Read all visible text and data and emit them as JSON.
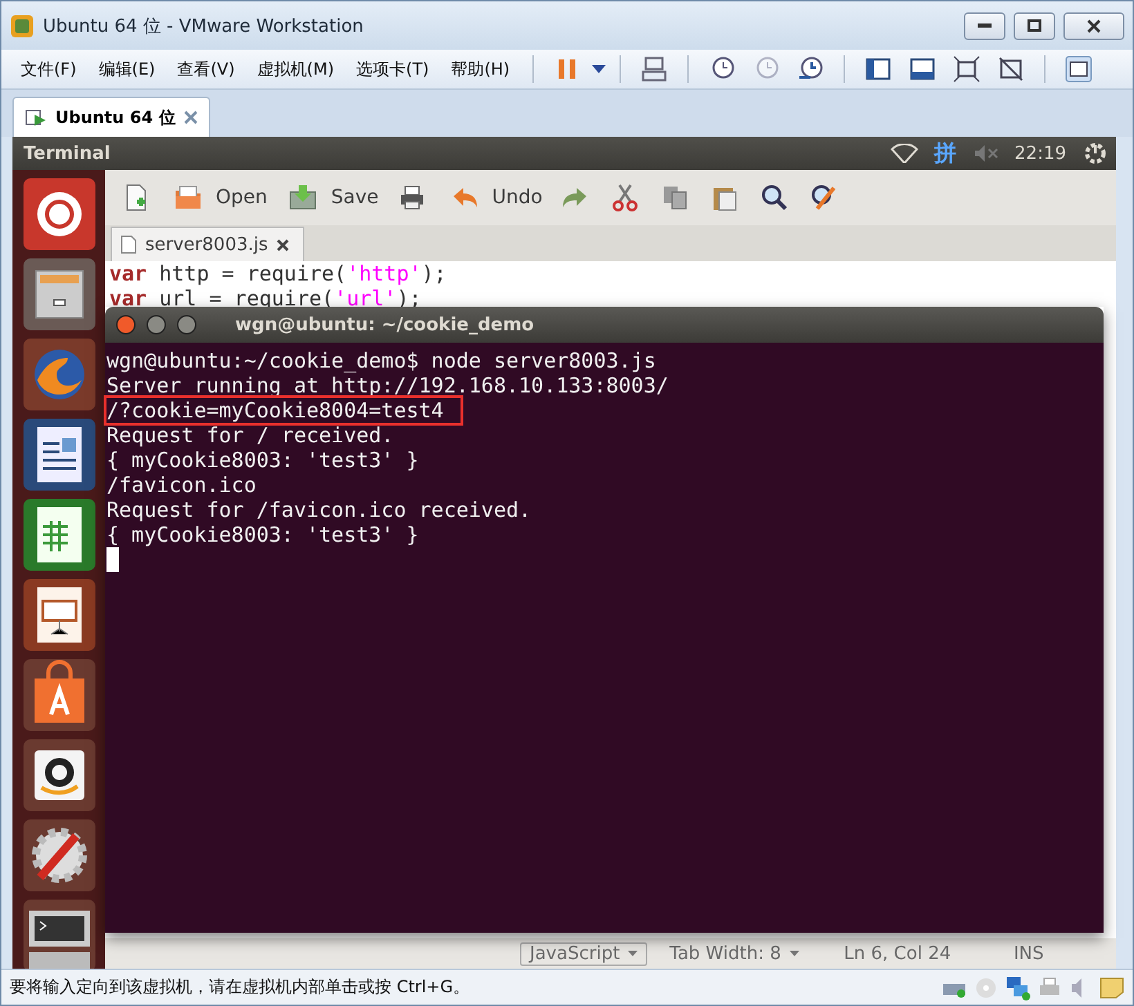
{
  "window": {
    "title": "Ubuntu 64 位 - VMware Workstation"
  },
  "menu": [
    "文件(F)",
    "编辑(E)",
    "查看(V)",
    "虚拟机(M)",
    "选项卡(T)",
    "帮助(H)"
  ],
  "tabs": [
    {
      "label": "Ubuntu 64 位",
      "selected": true
    }
  ],
  "ubuntu_panel": {
    "app_title": "Terminal",
    "input_method": "拼",
    "clock": "22:19"
  },
  "editor": {
    "toolbar": [
      {
        "kind": "new"
      },
      {
        "kind": "open",
        "label": "Open"
      },
      {
        "kind": "save",
        "label": "Save"
      },
      {
        "kind": "print"
      },
      {
        "kind": "undo",
        "label": "Undo"
      },
      {
        "kind": "redo"
      },
      {
        "kind": "cut"
      },
      {
        "kind": "copy"
      },
      {
        "kind": "paste"
      },
      {
        "kind": "find"
      },
      {
        "kind": "replace"
      }
    ],
    "file_tab": "server8003.js",
    "code": [
      [
        {
          "kind": "keyword",
          "text": "var"
        },
        {
          "kind": "plain",
          "text": " http = require("
        },
        {
          "kind": "string",
          "text": "'http'"
        },
        {
          "kind": "plain",
          "text": ");"
        }
      ],
      [
        {
          "kind": "keyword",
          "text": "var"
        },
        {
          "kind": "plain",
          "text": " url = require("
        },
        {
          "kind": "string",
          "text": "'url'"
        },
        {
          "kind": "plain",
          "text": ");"
        }
      ]
    ],
    "status": {
      "language": "JavaScript",
      "tab_width": "Tab Width: 8",
      "position": "Ln 6, Col 24",
      "mode": "INS"
    }
  },
  "terminal": {
    "title": "wgn@ubuntu: ~/cookie_demo",
    "lines": [
      {
        "text": "wgn@ubuntu:~/cookie_demo$ node server8003.js",
        "highlighted": false
      },
      {
        "text": "Server running at http://192.168.10.133:8003/",
        "highlighted": false
      },
      {
        "text": "/?cookie=myCookie8004=test4",
        "highlighted": true
      },
      {
        "text": "Request for / received.",
        "highlighted": false
      },
      {
        "text": "{ myCookie8003: 'test3' }",
        "highlighted": false
      },
      {
        "text": "/favicon.ico",
        "highlighted": false
      },
      {
        "text": "Request for /favicon.ico received.",
        "highlighted": false
      },
      {
        "text": "{ myCookie8003: 'test3' }",
        "highlighted": false
      }
    ]
  },
  "status_bar": {
    "message": "要将输入定向到该虚拟机，请在虚拟机内部单击或按 Ctrl+G。"
  }
}
